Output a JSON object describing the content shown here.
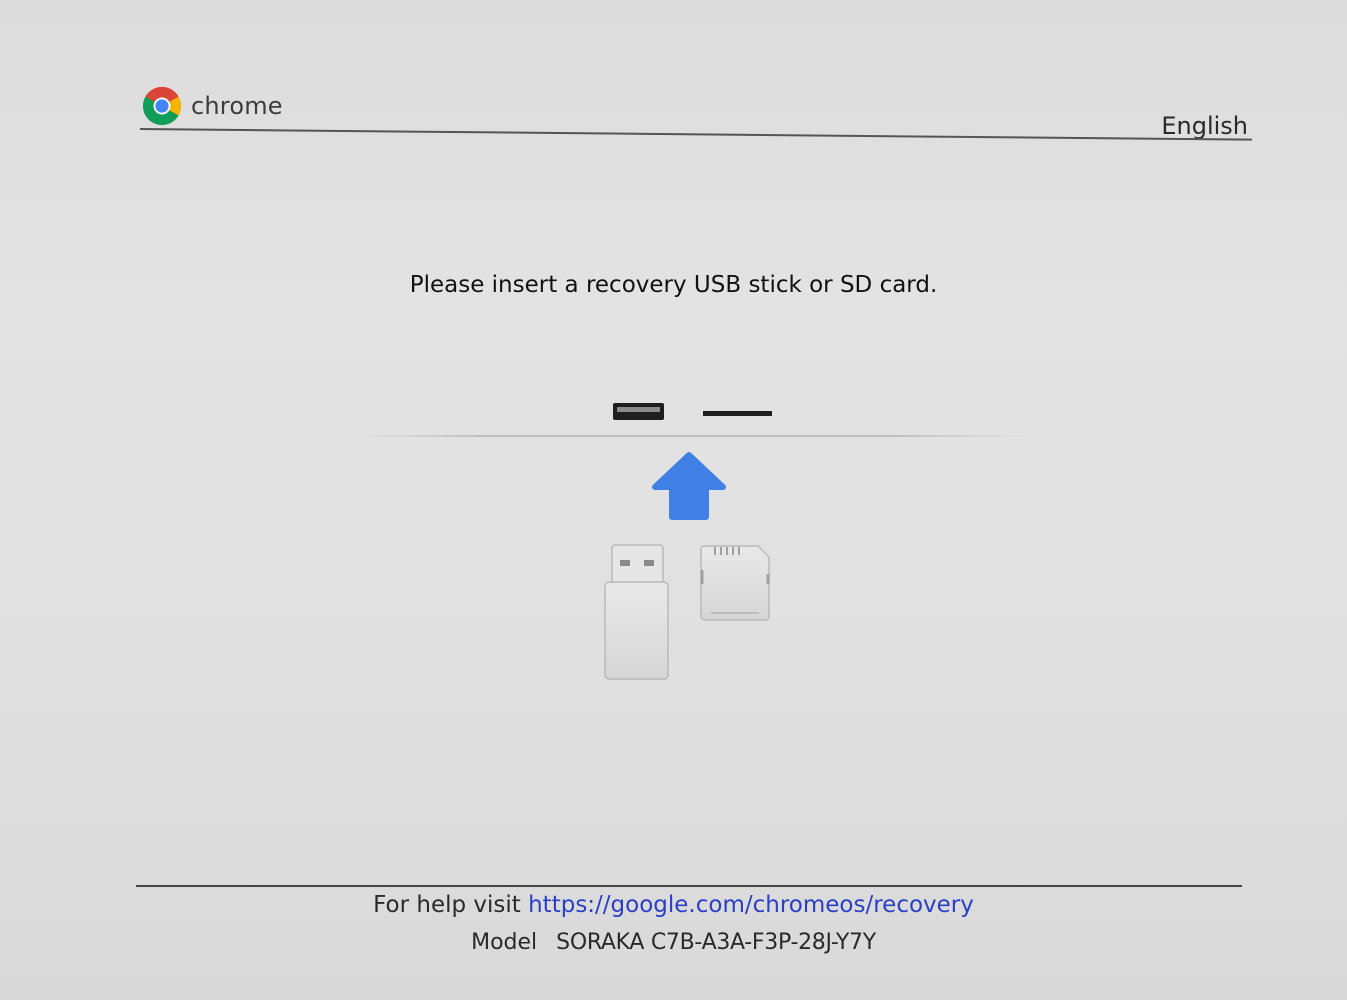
{
  "header": {
    "brand": "chrome",
    "language": "English"
  },
  "main": {
    "instruction": "Please insert a recovery USB stick or SD card."
  },
  "footer": {
    "help_prefix": "For help visit",
    "help_url": "https://google.com/chromeos/recovery",
    "model_label": "Model",
    "model_value": "SORAKA C7B-A3A-F3P-28J-Y7Y"
  },
  "icons": {
    "logo": "chrome-logo-icon",
    "arrow": "up-arrow-icon",
    "usb_port": "usb-port-icon",
    "sd_slot": "sd-slot-icon",
    "usb_stick": "usb-stick-icon",
    "sd_card": "sd-card-icon"
  },
  "colors": {
    "link": "#2a3fc7",
    "arrow": "#3f7fe6"
  }
}
